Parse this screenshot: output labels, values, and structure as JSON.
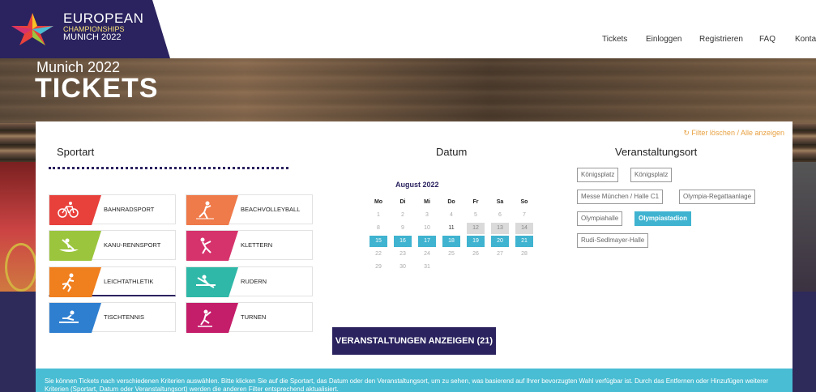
{
  "header": {
    "logo": {
      "line1": "EUROPEAN",
      "line2": "CHAMPIONSHIPS",
      "line3": "MUNICH 2022"
    },
    "nav": [
      "Tickets",
      "Einloggen",
      "Registrieren",
      "FAQ",
      "Kontakt"
    ]
  },
  "hero": {
    "subtitle": "Munich 2022",
    "title": "TICKETS"
  },
  "filters": {
    "reset_label": "Filter löschen / Alle anzeigen",
    "sport_title": "Sportart",
    "date_title": "Datum",
    "venue_title": "Veranstaltungsort"
  },
  "sports": [
    {
      "label": "BAHNRADSPORT",
      "color": "#e8413c"
    },
    {
      "label": "BEACHVOLLEYBALL",
      "color": "#ef7a4a"
    },
    {
      "label": "KANU-RENNSPORT",
      "color": "#9bc53d"
    },
    {
      "label": "KLETTERN",
      "color": "#d6336c"
    },
    {
      "label": "LEICHTATHLETIK",
      "color": "#f07f1e"
    },
    {
      "label": "RUDERN",
      "color": "#2fb8a8"
    },
    {
      "label": "TISCHTENNIS",
      "color": "#2f7fd0"
    },
    {
      "label": "TURNEN",
      "color": "#c41d6a"
    }
  ],
  "calendar": {
    "month": "August 2022",
    "weekdays": [
      "Mo",
      "Di",
      "Mi",
      "Do",
      "Fr",
      "Sa",
      "So"
    ],
    "rows": [
      [
        "1",
        "2",
        "3",
        "4",
        "5",
        "6",
        "7"
      ],
      [
        "8",
        "9",
        "10",
        "11",
        "12",
        "13",
        "14"
      ],
      [
        "15",
        "16",
        "17",
        "18",
        "19",
        "20",
        "21"
      ],
      [
        "22",
        "23",
        "24",
        "25",
        "26",
        "27",
        "28"
      ],
      [
        "29",
        "30",
        "31",
        "",
        "",
        "",
        ""
      ]
    ],
    "available_days": [
      "12",
      "13",
      "14"
    ],
    "selected_days": [
      "15",
      "16",
      "17",
      "18",
      "19",
      "20",
      "21"
    ],
    "dark_days": [
      "11"
    ]
  },
  "venues": [
    {
      "label": "Königsplatz",
      "selected": false
    },
    {
      "label": "Königsplatz",
      "selected": false
    },
    {
      "label": "Messe München / Halle C1",
      "selected": false
    },
    {
      "label": "Olympia-Regattaanlage",
      "selected": false
    },
    {
      "label": "Olympiahalle",
      "selected": false
    },
    {
      "label": "Olympiastadion",
      "selected": true
    },
    {
      "label": "Rudi-Sedlmayer-Halle",
      "selected": false
    }
  ],
  "show_button": "VERANSTALTUNGEN ANZEIGEN (21)",
  "info_text": "Sie können Tickets nach verschiedenen Kriterien auswählen. Bitte klicken Sie auf die Sportart, das Datum oder den Veranstaltungsort, um zu sehen, was basierend auf Ihrer bevorzugten Wahl verfügbar ist. Durch das Entfernen oder Hinzufügen weiterer Kriterien (Sportart, Datum oder Veranstaltungsort) werden die anderen Filter entsprechend aktualisiert."
}
